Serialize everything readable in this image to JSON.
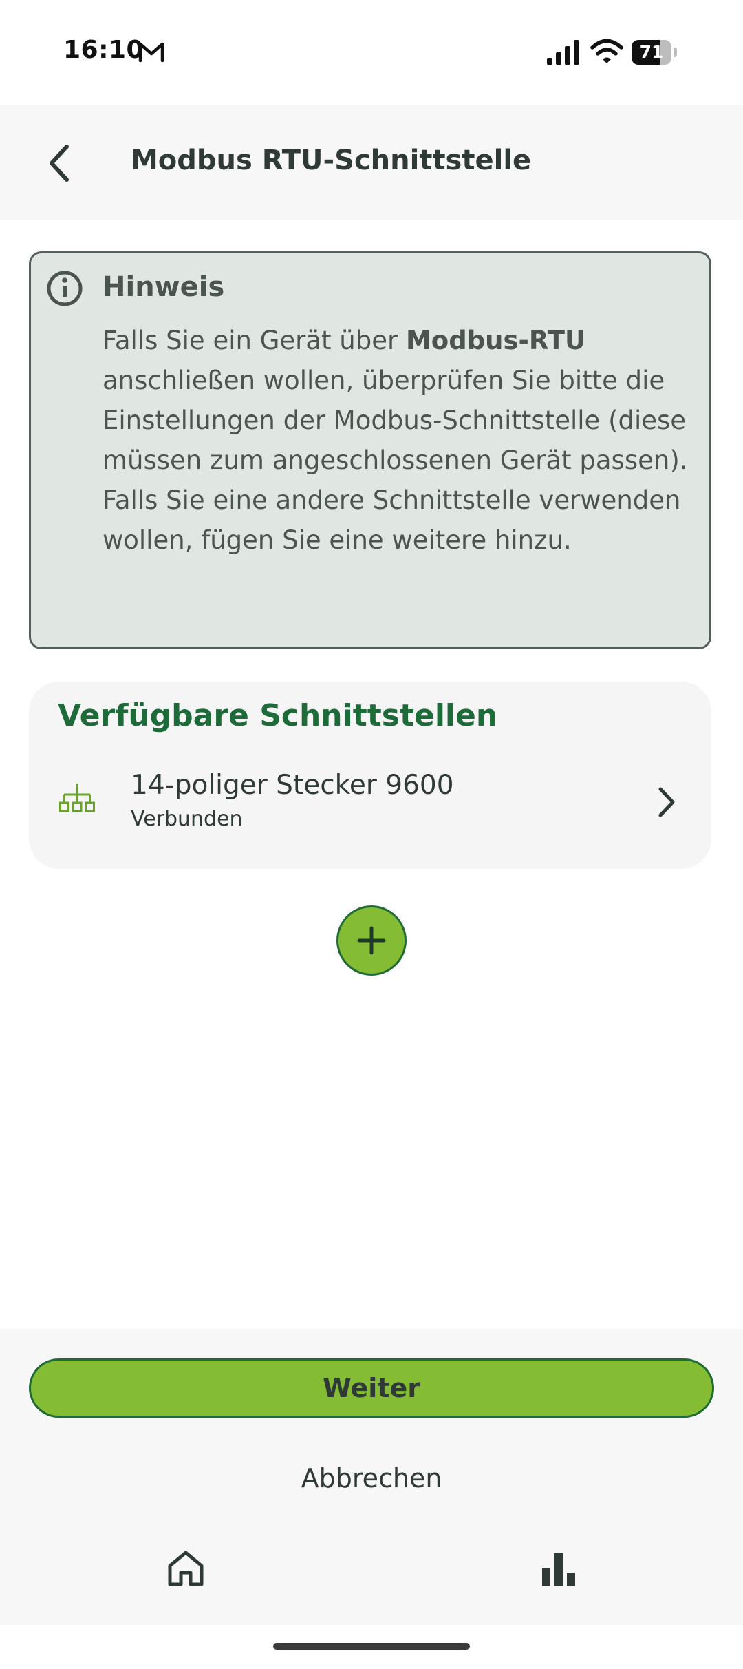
{
  "status_bar": {
    "time": "16:10",
    "battery_percent": 71,
    "battery_label": "71"
  },
  "header": {
    "title": "Modbus RTU-Schnittstelle"
  },
  "notice": {
    "title": "Hinweis",
    "text_part1": "Falls Sie ein Gerät über ",
    "text_bold": "Modbus-RTU",
    "text_part2": " anschließen wollen, überprüfen Sie bitte die Einstellungen der Modbus-Schnittstelle (diese müssen zum angeschlossenen Gerät passen). Falls Sie eine andere Schnittstelle verwenden wollen, fügen Sie eine weitere hinzu."
  },
  "interfaces": {
    "title": "Verfügbare Schnittstellen",
    "items": [
      {
        "name": "14-poliger Stecker 9600",
        "status": "Verbunden"
      }
    ]
  },
  "actions": {
    "next_label": "Weiter",
    "cancel_label": "Abbrechen"
  },
  "colors": {
    "accent_green": "#84bc34",
    "dark_green": "#1e6b3a",
    "notice_bg": "#e0e6e1",
    "text": "#2f3a36"
  },
  "icons": {
    "back": "chevron-left-icon",
    "info": "info-circle-icon",
    "network": "network-tree-icon",
    "chevron": "chevron-right-icon",
    "add": "plus-icon",
    "home": "home-icon",
    "stats": "bar-chart-icon"
  }
}
